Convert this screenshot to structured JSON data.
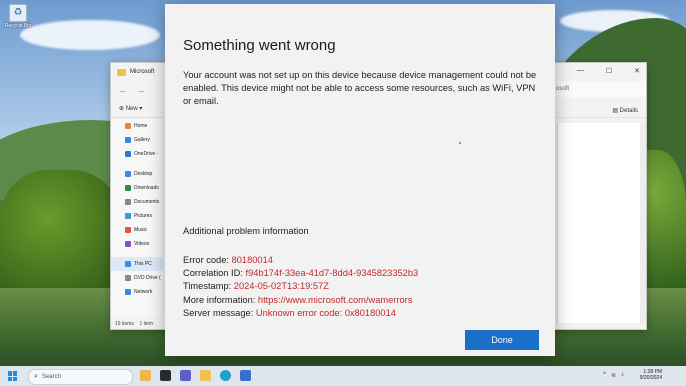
{
  "desktop": {
    "recycle_bin_label": "Recycle Bin"
  },
  "explorer": {
    "title": "Microsoft",
    "new_label": "New",
    "search_placeholder": "osoft",
    "details_label": "Details",
    "sidebar": [
      {
        "label": "Home",
        "icon": "home-icon",
        "color": "#e4883d"
      },
      {
        "label": "Gallery",
        "icon": "gallery-icon",
        "color": "#3c8be0"
      },
      {
        "label": "OneDrive -",
        "icon": "cloud-icon",
        "color": "#2f78d0"
      },
      {
        "label": "Desktop",
        "icon": "desktop-icon",
        "color": "#3c8be0"
      },
      {
        "label": "Downloads",
        "icon": "download-icon",
        "color": "#2e8b57"
      },
      {
        "label": "Documents",
        "icon": "documents-icon",
        "color": "#7a8a99"
      },
      {
        "label": "Pictures",
        "icon": "pictures-icon",
        "color": "#3a9bd7"
      },
      {
        "label": "Music",
        "icon": "music-icon",
        "color": "#e0573c"
      },
      {
        "label": "Videos",
        "icon": "videos-icon",
        "color": "#8a4fc8"
      },
      {
        "label": "This PC",
        "icon": "pc-icon",
        "color": "#3c8be0"
      },
      {
        "label": "DVD Drive (",
        "icon": "dvd-icon",
        "color": "#888888"
      },
      {
        "label": "Network",
        "icon": "network-icon",
        "color": "#3c8be0"
      }
    ],
    "status_items": "19 items",
    "status_selected": "1 item"
  },
  "dialog": {
    "title": "Something went wrong",
    "message": "Your account was not set up on this device because device management could not be enabled. This device might not be able to access some resources, such as WiFi, VPN or email.",
    "subheading": "Additional problem information",
    "error_code_label": "Error code: ",
    "error_code": "80180014",
    "correlation_label": "Correlation ID: ",
    "correlation_id": "f94b174f-33ea-41d7-8dd4-9345823352b3",
    "timestamp_label": "Timestamp: ",
    "timestamp": "2024-05-02T13:19:57Z",
    "more_info_label": "More information: ",
    "more_info_url": "https://www.microsoft.com/wamerrors",
    "server_msg_label": "Server message: ",
    "server_msg": "Unknown error code: 0x80180014",
    "done_label": "Done",
    "accent_color": "#1a6fc8",
    "error_color": "#c3272b"
  },
  "taskbar": {
    "search_placeholder": "Search",
    "time": "1:28 PM",
    "date": "9/20/2024"
  }
}
